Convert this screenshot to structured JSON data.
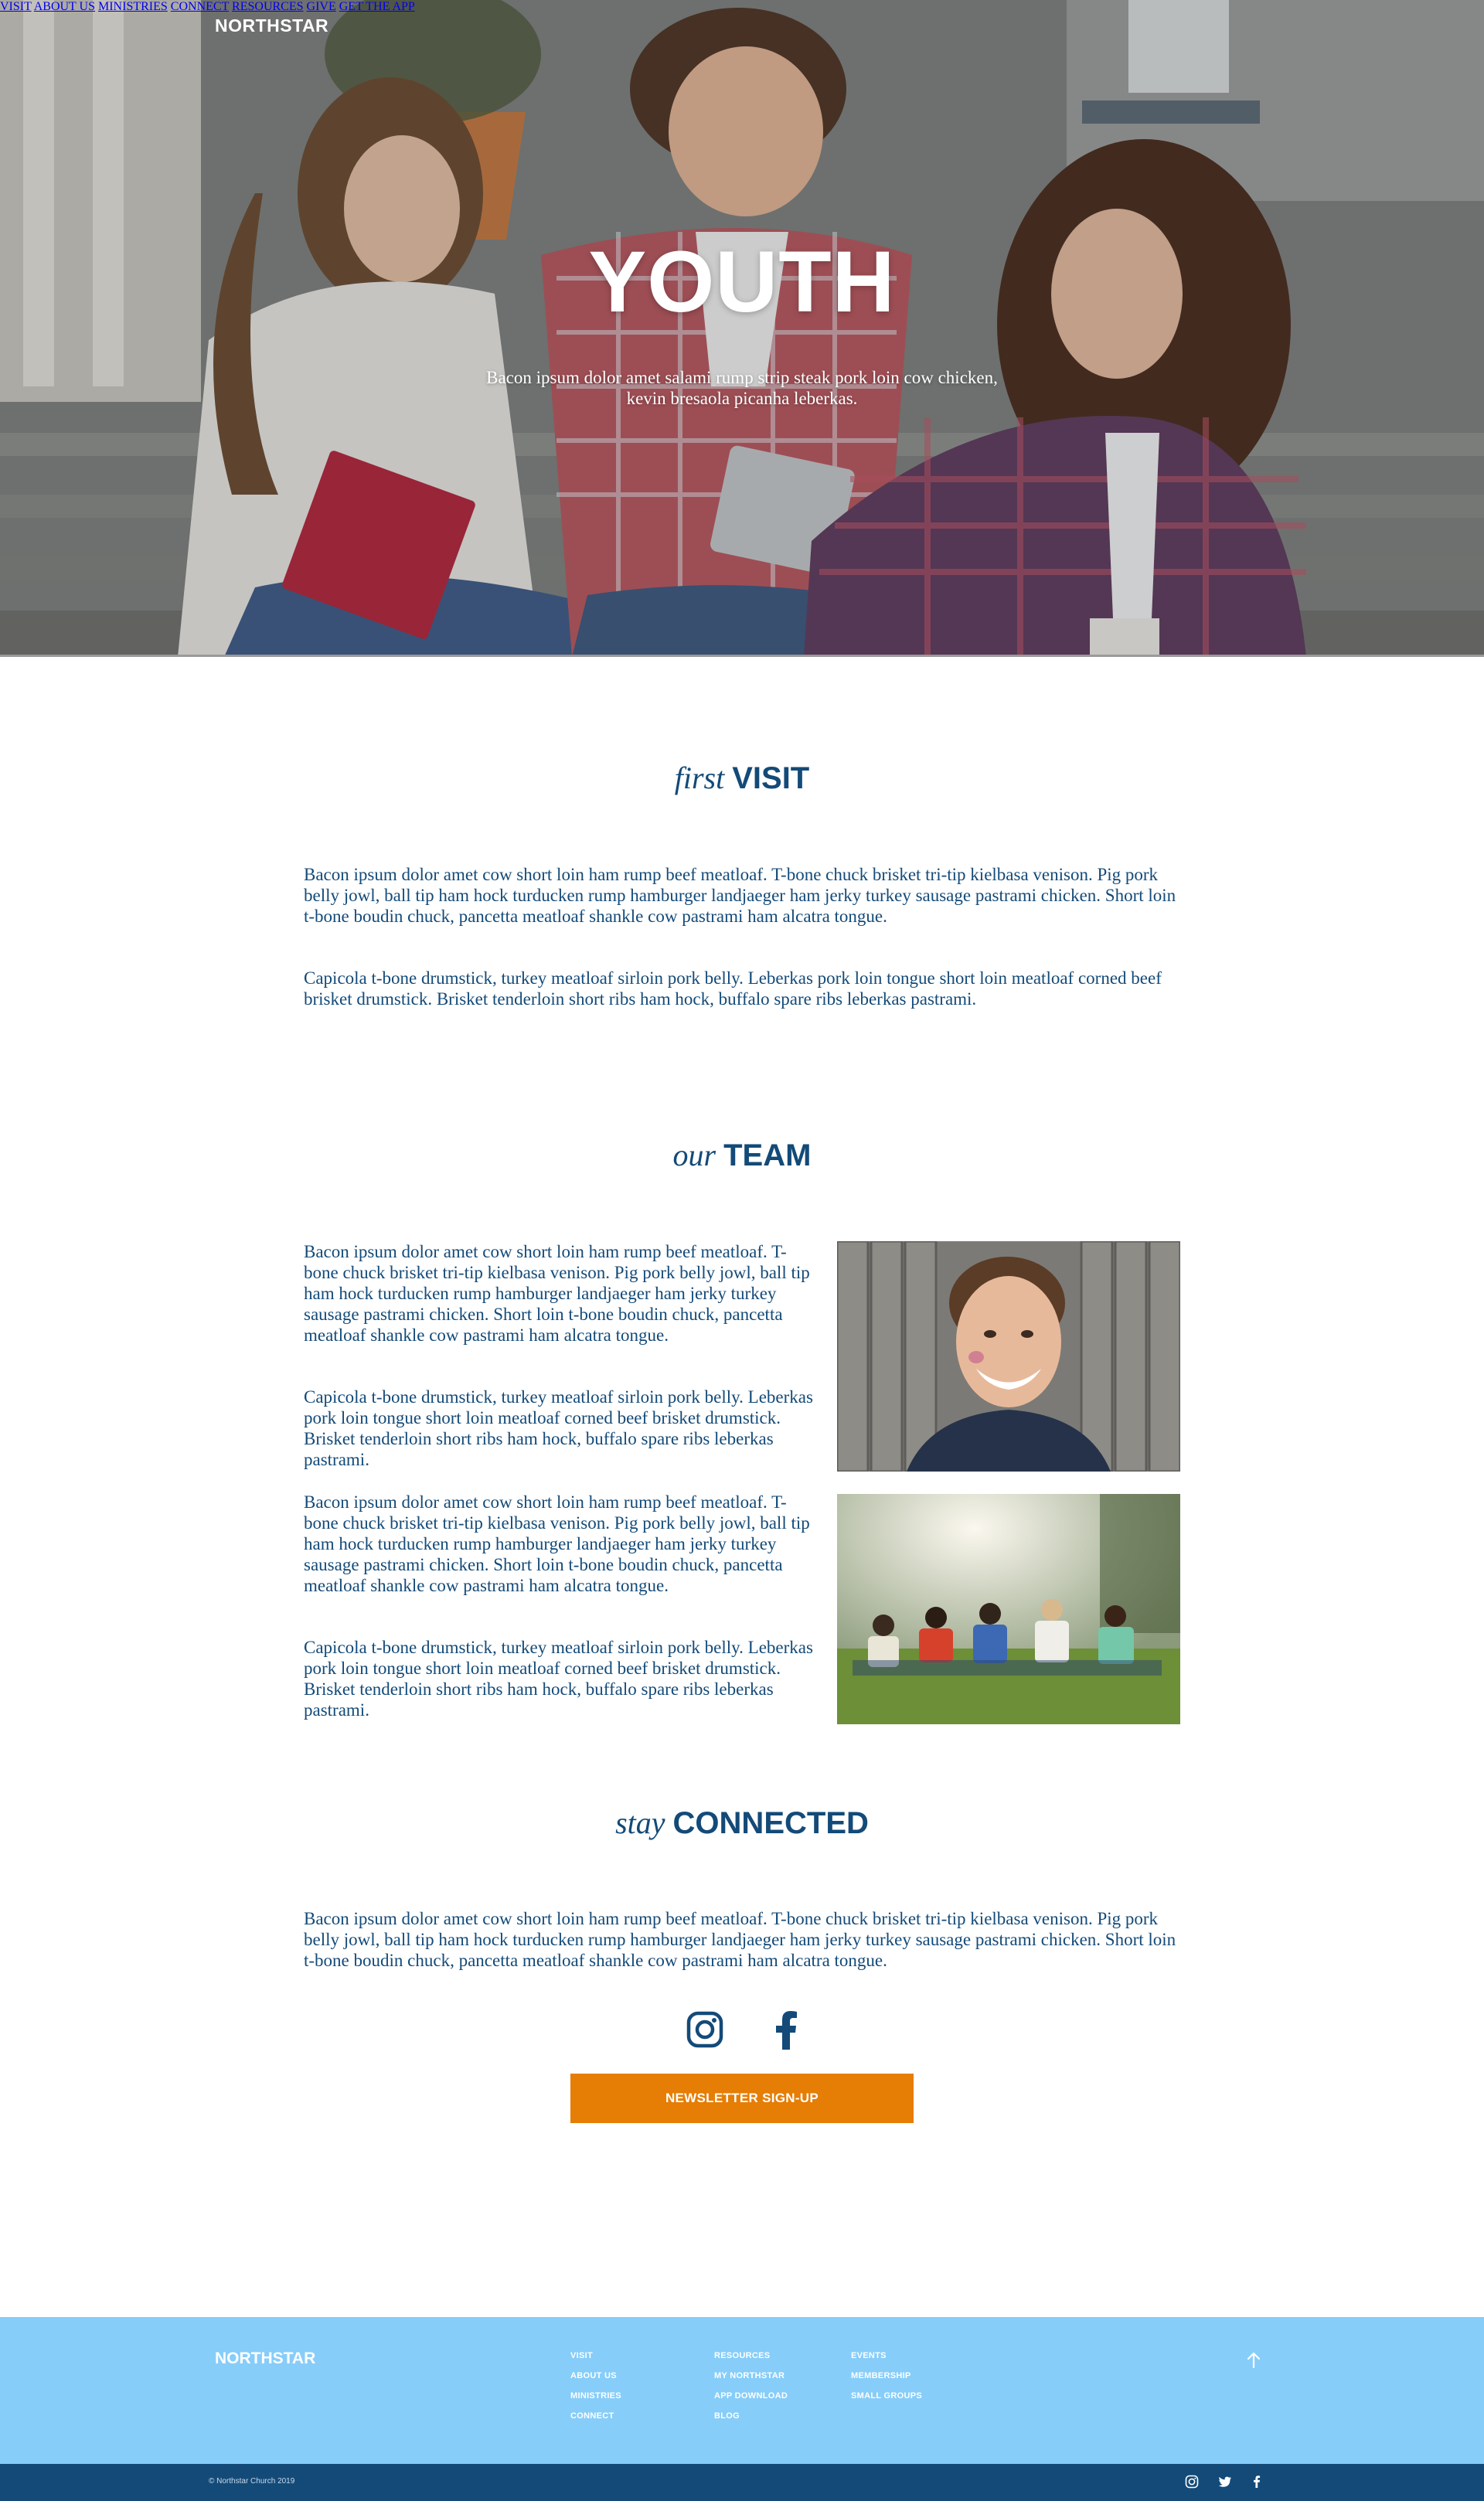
{
  "nav": {
    "brand": "NORTHSTAR",
    "items": [
      "VISIT",
      "ABOUT US",
      "MINISTRIES",
      "CONNECT",
      "RESOURCES",
      "GIVE",
      "GET THE APP"
    ]
  },
  "hero": {
    "title": "YOUTH",
    "subtitle": "Bacon ipsum dolor amet salami rump strip steak pork loin cow chicken, kevin bresaola picanha leberkas."
  },
  "visit": {
    "title_script": "first",
    "title_bold": "VISIT",
    "paragraphs": [
      "Bacon ipsum dolor amet cow short loin ham rump beef meatloaf. T-bone chuck brisket tri-tip kielbasa venison. Pig pork belly jowl, ball tip ham hock turducken rump hamburger landjaeger ham jerky turkey sausage pastrami chicken. Short loin t-bone boudin chuck, pancetta meatloaf shankle cow pastrami ham alcatra tongue.",
      "Capicola t-bone drumstick, turkey meatloaf sirloin pork belly. Leberkas pork loin tongue short loin meatloaf corned beef brisket drumstick. Brisket tenderloin short ribs ham hock, buffalo spare ribs leberkas pastrami."
    ]
  },
  "team": {
    "title_script": "our",
    "title_bold": "TEAM",
    "paragraphs": [
      "Bacon ipsum dolor amet cow short loin ham rump beef meatloaf. T-bone chuck brisket tri-tip kielbasa venison. Pig pork belly jowl, ball tip ham hock turducken rump hamburger landjaeger ham jerky turkey sausage pastrami chicken. Short loin t-bone boudin chuck, pancetta meatloaf shankle cow pastrami ham alcatra tongue.",
      "Capicola t-bone drumstick, turkey meatloaf sirloin pork belly. Leberkas pork loin tongue short loin meatloaf corned beef brisket drumstick. Brisket tenderloin short ribs ham hock, buffalo spare ribs leberkas pastrami.",
      "Bacon ipsum dolor amet cow short loin ham rump beef meatloaf. T-bone chuck brisket tri-tip kielbasa venison. Pig pork belly jowl, ball tip ham hock turducken rump hamburger landjaeger ham jerky turkey sausage pastrami chicken. Short loin t-bone boudin chuck, pancetta meatloaf shankle cow pastrami ham alcatra tongue.",
      "Capicola t-bone drumstick, turkey meatloaf sirloin pork belly. Leberkas pork loin tongue short loin meatloaf corned beef brisket drumstick. Brisket tenderloin short ribs ham hock, buffalo spare ribs leberkas pastrami."
    ]
  },
  "connected": {
    "title_script": "stay",
    "title_bold": "CONNECTED",
    "paragraph": "Bacon ipsum dolor amet cow short loin ham rump beef meatloaf. T-bone chuck brisket tri-tip kielbasa venison. Pig pork belly jowl, ball tip ham hock turducken rump hamburger landjaeger ham jerky turkey sausage pastrami chicken. Short loin t-bone boudin chuck, pancetta meatloaf shankle cow pastrami ham alcatra tongue.",
    "social_icons": [
      "instagram-icon",
      "facebook-icon"
    ],
    "button_label": "NEWSLETTER SIGN-UP"
  },
  "footer": {
    "brand": "NORTHSTAR",
    "col1": [
      "VISIT",
      "ABOUT US",
      "MINISTRIES",
      "CONNECT"
    ],
    "col2": [
      "RESOURCES",
      "MY NORTHSTAR",
      "APP DOWNLOAD",
      "BLOG"
    ],
    "col3": [
      "EVENTS",
      "MEMBERSHIP",
      "SMALL GROUPS"
    ],
    "copyright": "© Northstar Church 2019",
    "icons": [
      "instagram-icon",
      "twitter-icon",
      "facebook-icon"
    ]
  },
  "colors": {
    "primary": "#134a78",
    "accent": "#e67d05",
    "footer_bg": "#87cdf9",
    "footer_bar": "#134a78"
  }
}
